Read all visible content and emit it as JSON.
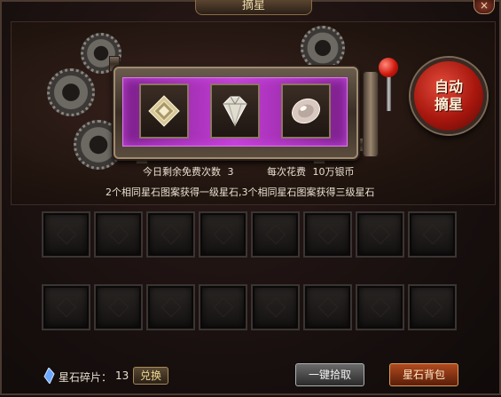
{
  "window": {
    "title": "摘星",
    "close_label": "×"
  },
  "slots": [
    {
      "gem": "star-gem-square",
      "color": "#e8d8a8"
    },
    {
      "gem": "star-gem-diamond",
      "color": "#f0ece0"
    },
    {
      "gem": "star-gem-oval",
      "color": "#e0d0c8"
    }
  ],
  "auto_button": {
    "line1": "自动",
    "line2": "摘星"
  },
  "info": {
    "free_label": "今日剩余免费次数",
    "free_count": "3",
    "cost_label": "每次花费",
    "cost_value": "10万银币",
    "rule_text": "2个相同星石图案获得一级星石,3个相同星石图案获得三级星石"
  },
  "grid": {
    "rows": 2,
    "cols": 8
  },
  "bottom": {
    "shard_label": "星石碎片：",
    "shard_count": "13",
    "exchange_label": "兑换",
    "collect_label": "一键拾取",
    "bag_label": "星石背包"
  },
  "colors": {
    "slot_purple": "#c43ed6",
    "auto_red": "#a8170e",
    "bag_orange": "#b04a1e"
  }
}
